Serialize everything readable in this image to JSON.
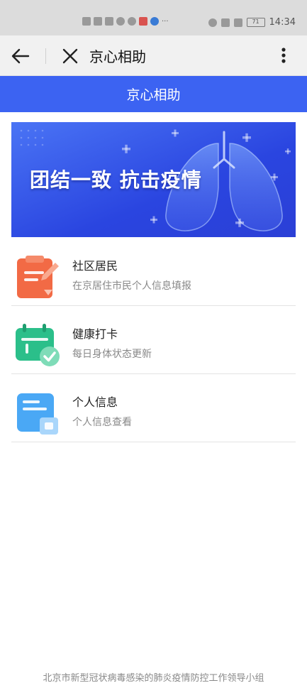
{
  "status_bar": {
    "left_icons": [
      "hd-icon",
      "signal-icon",
      "wifi-icon",
      "wechat-icon",
      "chat-icon",
      "calendar-icon",
      "browser-icon"
    ],
    "more": "···",
    "battery": "71",
    "time": "14:34"
  },
  "nav": {
    "title": "京心相助"
  },
  "header": {
    "title": "京心相助"
  },
  "banner": {
    "text": "团结一致 抗击疫情"
  },
  "menu": {
    "items": [
      {
        "title": "社区居民",
        "subtitle": "在京居住市民个人信息填报",
        "icon": "clipboard-icon"
      },
      {
        "title": "健康打卡",
        "subtitle": "每日身体状态更新",
        "icon": "calendar-check-icon"
      },
      {
        "title": "个人信息",
        "subtitle": "个人信息查看",
        "icon": "id-card-icon"
      }
    ]
  },
  "footer": {
    "text": "北京市新型冠状病毒感染的肺炎疫情防控工作领导小组"
  },
  "colors": {
    "primary": "#3c63f2",
    "banner_dark": "#1f3bd8",
    "orange": "#f26a45",
    "green": "#2bbf8a",
    "light_blue": "#4aa8f5"
  }
}
